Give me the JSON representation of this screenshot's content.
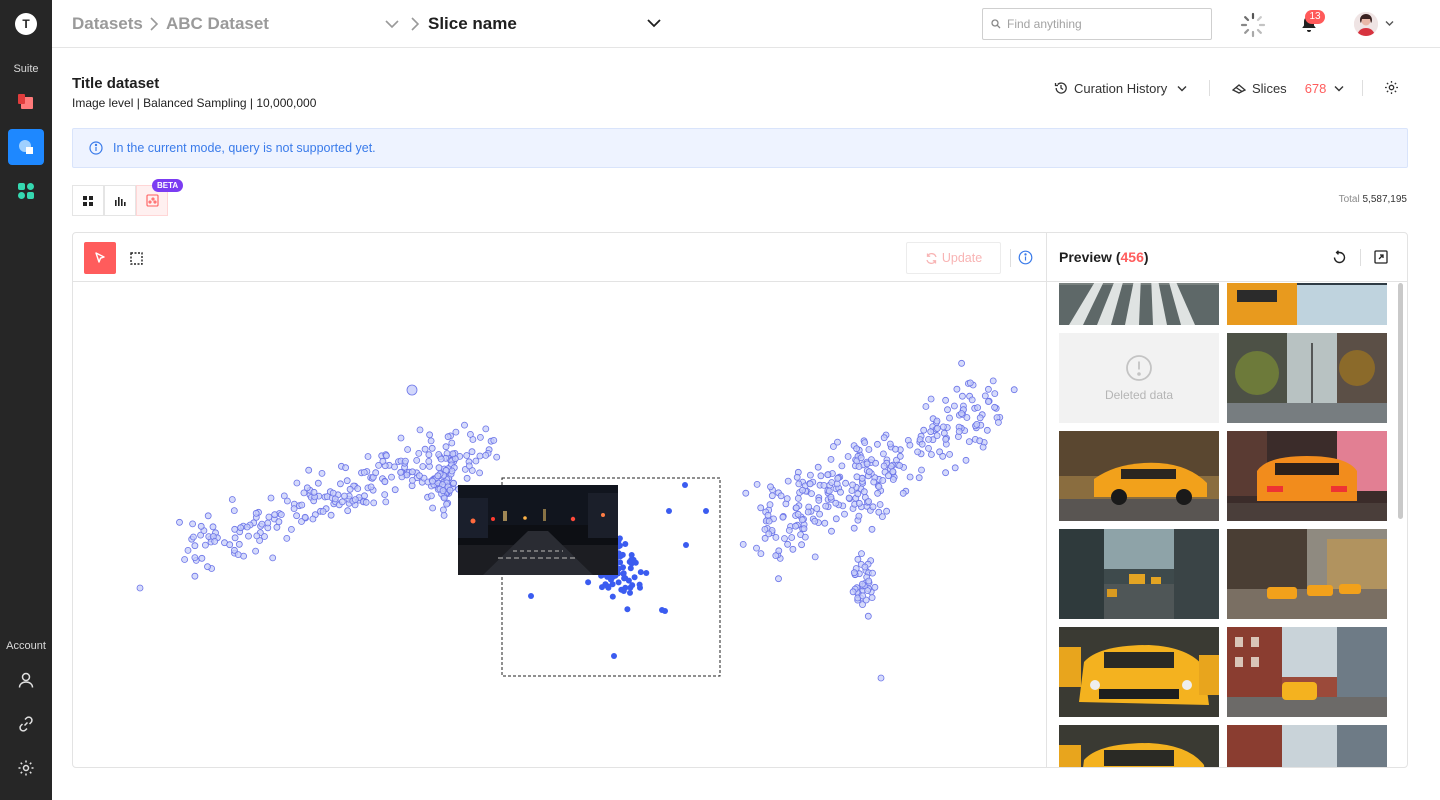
{
  "app": {
    "logo_letter": "T"
  },
  "rail": {
    "suite_label": "Suite",
    "account_label": "Account"
  },
  "breadcrumb": {
    "datasets": "Datasets",
    "dataset": "ABC Dataset",
    "slice": "Slice name"
  },
  "search": {
    "placeholder": "Find anytihing"
  },
  "notifications": {
    "count": "13"
  },
  "dataset": {
    "title": "Title dataset",
    "subtitle": "Image level | Balanced Sampling | 10,000,000"
  },
  "header_actions": {
    "curation_history": "Curation History",
    "slices_label": "Slices",
    "slices_count": "678"
  },
  "banner": {
    "text": "In the current mode, query is not supported yet."
  },
  "view_tabs": {
    "beta_label": "BETA"
  },
  "total": {
    "label": "Total",
    "value": "5,587,195"
  },
  "plot_toolbar": {
    "update_label": "Update"
  },
  "preview": {
    "title": "Preview",
    "count": "456",
    "deleted_label": "Deleted data"
  },
  "colors": {
    "accent_red": "#ff5c5c",
    "point_fill": "#c7cdfa",
    "point_stroke": "#6b74e8",
    "selected_point": "#3b5cf0",
    "rail_bg": "#262626",
    "active_blue": "#1e88ff",
    "beta_purple": "#7b3cf2"
  }
}
